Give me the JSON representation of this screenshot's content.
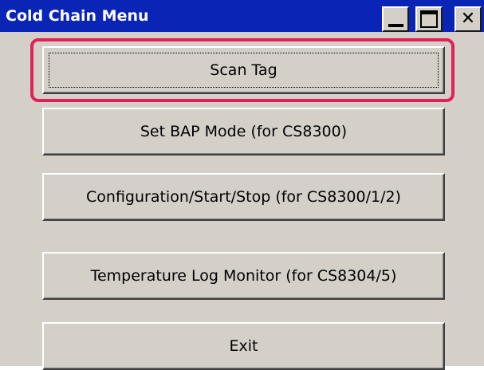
{
  "window": {
    "title": "Cold Chain Menu",
    "controls": {
      "minimize_icon": "minimize-icon",
      "maximize_icon": "maximize-icon",
      "close_icon": "close-icon",
      "close_glyph": "✕"
    }
  },
  "menu": {
    "buttons": [
      {
        "label": "Scan Tag",
        "focused": true
      },
      {
        "label": "Set BAP Mode (for CS8300)"
      },
      {
        "label": "Configuration/Start/Stop (for CS8300/1/2)"
      },
      {
        "label": "Temperature Log Monitor (for CS8304/5)"
      },
      {
        "label": "Exit"
      }
    ]
  },
  "colors": {
    "titlebar": "#0a24b6",
    "face": "#d4d0c8",
    "highlight": "#e0205a"
  }
}
